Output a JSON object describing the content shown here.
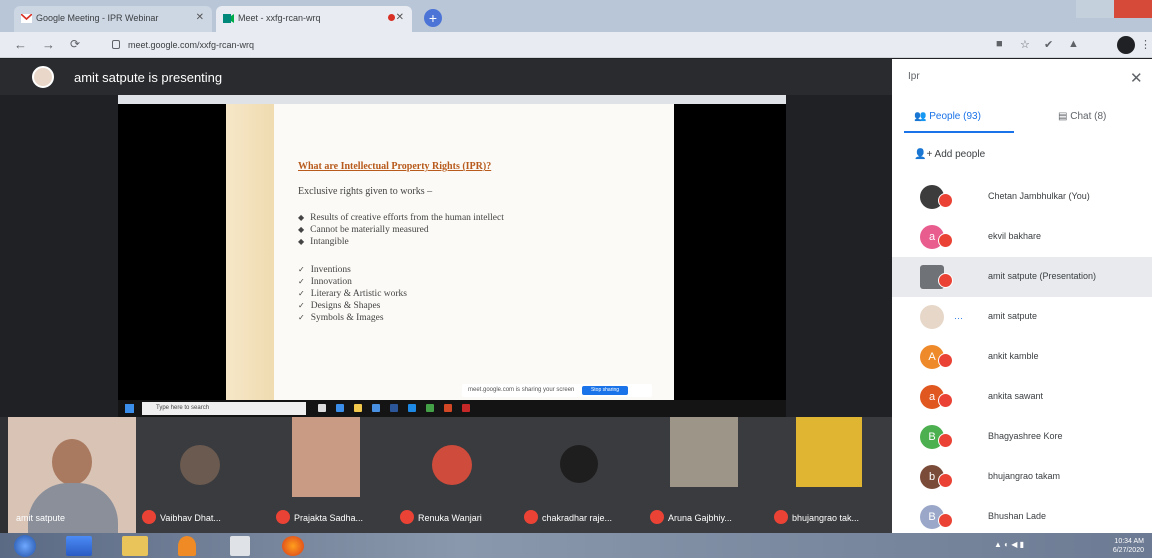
{
  "browser": {
    "tabs": [
      {
        "label": "Google Meeting - IPR Webinar",
        "active": false
      },
      {
        "label": "Meet - xxfg-rcan-wrq",
        "active": true
      }
    ],
    "url": "meet.google.com/xxfg-rcan-wrq"
  },
  "presenter": {
    "label": "amit satpute is presenting"
  },
  "slide": {
    "title": "What are Intellectual Property Rights (IPR)?",
    "subtitle": "Exclusive rights given to works –",
    "bullets_a": [
      "Results of creative efforts from the human intellect",
      "Cannot be materially measured",
      "Intangible"
    ],
    "bullets_b": [
      "Inventions",
      "Innovation",
      "Literary & Artistic works",
      "Designs & Shapes",
      "Symbols & Images"
    ],
    "share_notice": "meet.google.com is sharing your screen",
    "stop_label": "Stop sharing",
    "search_placeholder": "Type here to search"
  },
  "tiles": [
    {
      "name": "amit satpute"
    },
    {
      "name": "Vaibhav Dhat..."
    },
    {
      "name": "Prajakta Sadha..."
    },
    {
      "name": "Renuka Wanjari"
    },
    {
      "name": "chakradhar raje..."
    },
    {
      "name": "Aruna Gajbhiy..."
    },
    {
      "name": "bhujangrao tak..."
    }
  ],
  "panel": {
    "title": "Ipr",
    "people_tab": "People (93)",
    "chat_tab": "Chat (8)",
    "add_people": "Add people",
    "participants": [
      {
        "name": "Chetan Jambhulkar (You)",
        "initial": "",
        "color": "#3c3c3c"
      },
      {
        "name": "ekvil bakhare",
        "initial": "a",
        "color": "#e85c8e"
      },
      {
        "name": "amit satpute (Presentation)",
        "initial": "",
        "color": "#6f7378"
      },
      {
        "name": "amit satpute",
        "initial": "",
        "color": "#e6d7c8"
      },
      {
        "name": "ankit kamble",
        "initial": "A",
        "color": "#ef8a2b"
      },
      {
        "name": "ankita sawant",
        "initial": "a",
        "color": "#e0571f"
      },
      {
        "name": "Bhagyashree Kore",
        "initial": "B",
        "color": "#4caf50"
      },
      {
        "name": "bhujangrao takam",
        "initial": "b",
        "color": "#7b4b3a"
      },
      {
        "name": "Bhushan Lade",
        "initial": "B",
        "color": "#9aa7c8"
      }
    ]
  },
  "taskbar": {
    "time": "10:34 AM",
    "date": "6/27/2020"
  },
  "colors": {
    "accent": "#1a73e8",
    "mic_off": "#ea4335",
    "stage": "#202124"
  }
}
